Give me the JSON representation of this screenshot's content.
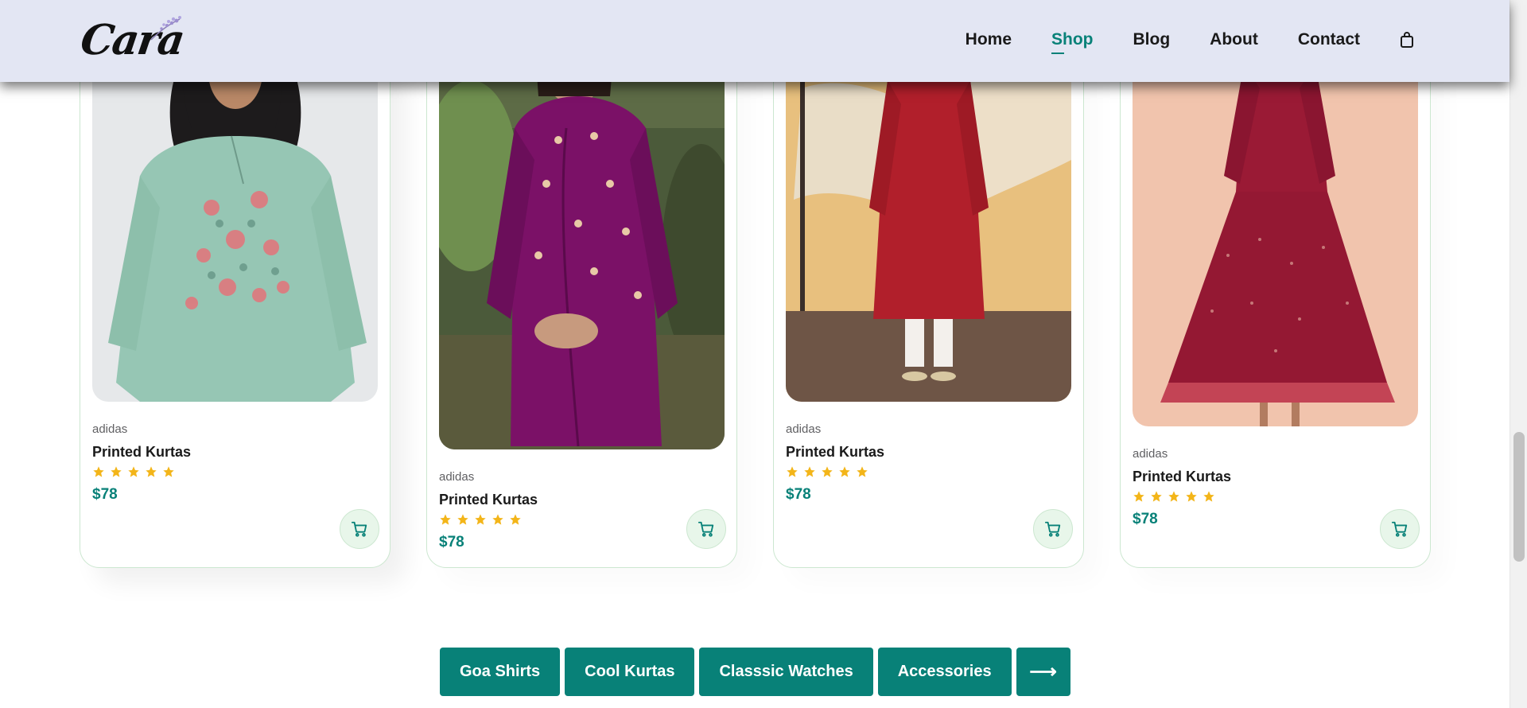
{
  "header": {
    "logo_text": "Cara",
    "nav": [
      "Home",
      "Shop",
      "Blog",
      "About",
      "Contact"
    ],
    "active_nav": "Shop",
    "bag_icon": "bag-icon"
  },
  "products": [
    {
      "brand": "adidas",
      "name": "Printed Kurtas",
      "rating": 5,
      "price": "$78",
      "cart_icon": "cart-icon"
    },
    {
      "brand": "adidas",
      "name": "Printed Kurtas",
      "rating": 5,
      "price": "$78",
      "cart_icon": "cart-icon"
    },
    {
      "brand": "adidas",
      "name": "Printed Kurtas",
      "rating": 5,
      "price": "$78",
      "cart_icon": "cart-icon"
    },
    {
      "brand": "adidas",
      "name": "Printed Kurtas",
      "rating": 5,
      "price": "$78",
      "cart_icon": "cart-icon"
    }
  ],
  "pagination": {
    "pages": [
      "Goa Shirts",
      "Cool Kurtas",
      "Classsic Watches",
      "Accessories"
    ],
    "next_label": "⟶"
  },
  "colors": {
    "accent": "#088178",
    "header_bg": "#e3e6f3",
    "star": "#f3b519"
  }
}
